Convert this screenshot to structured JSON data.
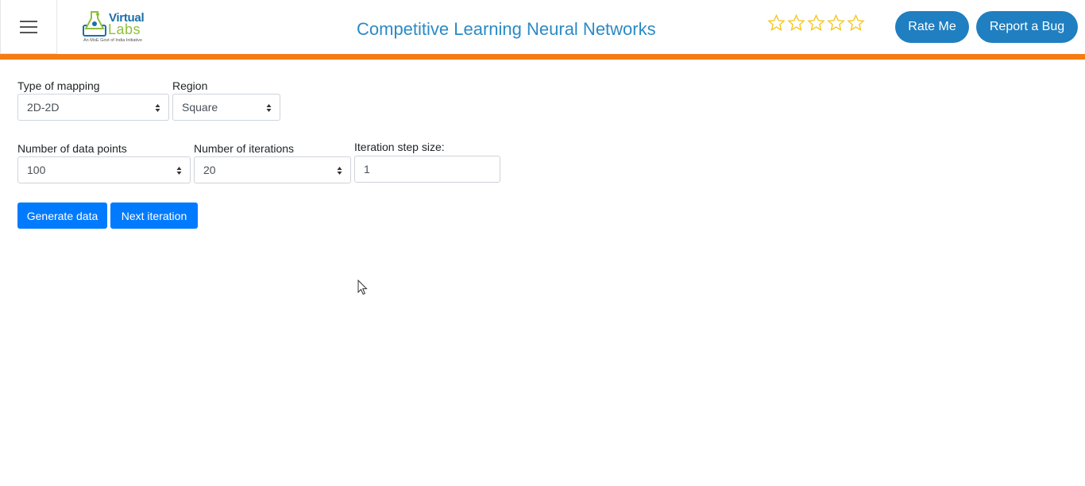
{
  "header": {
    "menu_icon": "hamburger-menu-icon",
    "logo": {
      "word1": "Virtual",
      "word2": "Labs",
      "tagline": "An MoE Govt of India Initiative"
    },
    "title": "Competitive Learning Neural Networks",
    "rating": {
      "stars_total": 5,
      "stars_filled": 0,
      "star_color": "#f5c518"
    },
    "rate_me_label": "Rate Me",
    "report_bug_label": "Report a Bug",
    "accent_color": "#f57c12",
    "button_color": "#1f7fc1"
  },
  "form": {
    "mapping": {
      "label": "Type of mapping",
      "value": "2D-2D"
    },
    "region": {
      "label": "Region",
      "value": "Square"
    },
    "data_points": {
      "label": "Number of data points",
      "value": "100"
    },
    "iterations": {
      "label": "Number of iterations",
      "value": "20"
    },
    "step_size": {
      "label": "Iteration step size:",
      "value": "1"
    }
  },
  "actions": {
    "generate_label": "Generate data",
    "next_label": "Next iteration",
    "button_color": "#007bff"
  }
}
